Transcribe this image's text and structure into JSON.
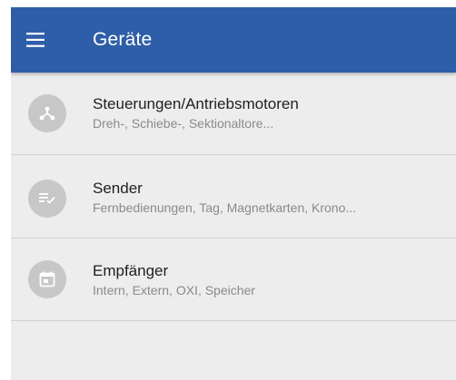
{
  "toolbar": {
    "title": "Geräte",
    "menu_icon": "hamburger-menu-icon",
    "background_color": "#2e5ea7"
  },
  "items": [
    {
      "title": "Steuerungen/Antriebsmotoren",
      "subtitle": "Dreh-, Schiebe-, Sektionaltore...",
      "icon": "control-unit-icon"
    },
    {
      "title": "Sender",
      "subtitle": "Fernbedienungen, Tag, Magnetkarten, Krono...",
      "icon": "transmitter-list-icon"
    },
    {
      "title": "Empfänger",
      "subtitle": "Intern, Extern, OXI, Speicher",
      "icon": "receiver-calendar-icon"
    }
  ]
}
